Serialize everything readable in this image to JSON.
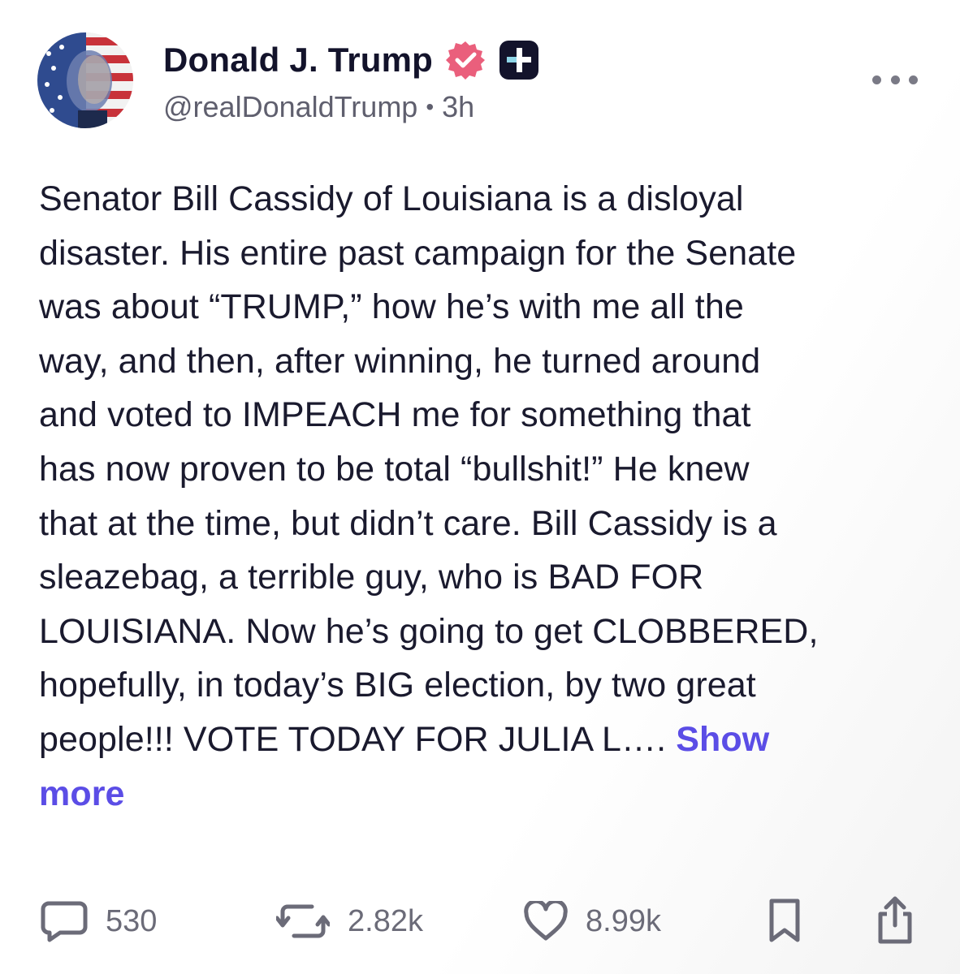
{
  "author": {
    "display_name": "Donald J. Trump",
    "handle": "@realDonaldTrump",
    "separator": "•",
    "time_ago": "3h",
    "verified_color": "#ea5f7c",
    "badge_color": "#13132b"
  },
  "post": {
    "lines": [
      "Senator Bill Cassidy of Louisiana is a disloyal",
      "disaster. His entire past campaign for the Senate",
      "was about “TRUMP,” how he’s with me all the",
      "way, and then, after winning, he turned around",
      "and voted to IMPEACH me for something that",
      "has now proven to be total “bullshit!” He knew",
      "that at the time, but didn’t care. Bill Cassidy is a",
      "sleazebag, a terrible guy, who is BAD FOR",
      "LOUISIANA. Now he’s going to get CLOBBERED,",
      "hopefully, in today’s BIG election, by two great",
      "people!!! VOTE TODAY FOR JULIA L…. "
    ],
    "show_more_part1": "Show",
    "show_more_part2": "more",
    "link_color": "#5b4de6"
  },
  "actions": {
    "reply_count": "530",
    "restruth_count": "2.82k",
    "like_count": "8.99k"
  },
  "icons": {
    "verified": "verified-badge-icon",
    "plus": "truth-plus-badge-icon",
    "more": "more-dots-icon",
    "reply": "comment-icon",
    "restruth": "repost-icon",
    "like": "heart-icon",
    "bookmark": "bookmark-icon",
    "share": "share-icon"
  }
}
